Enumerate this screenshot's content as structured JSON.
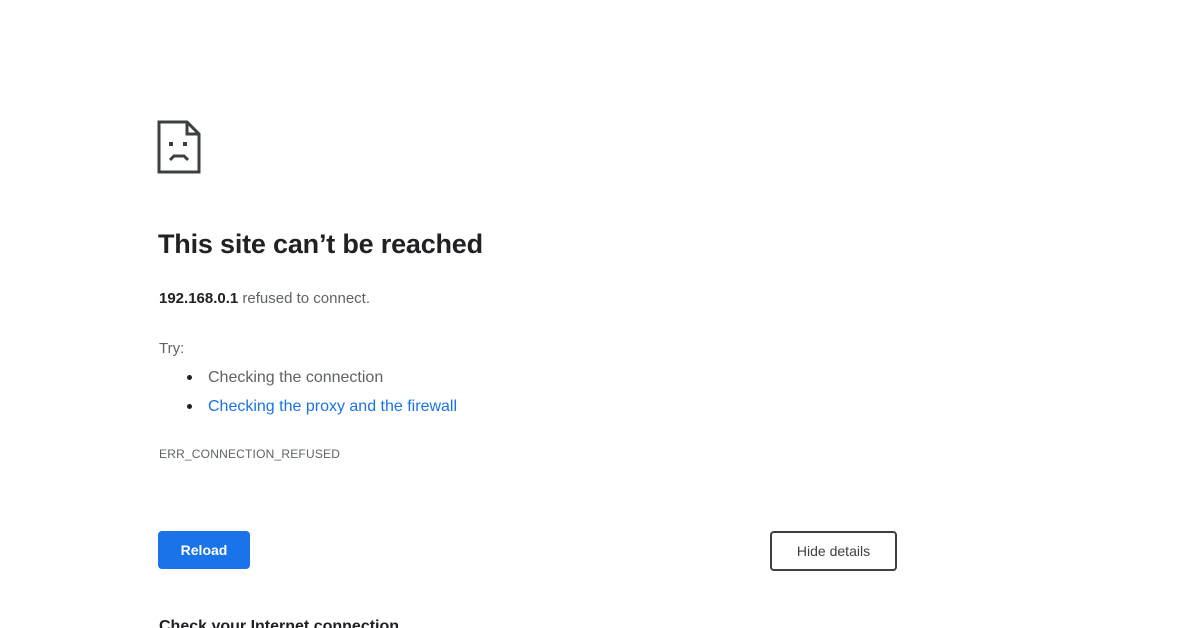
{
  "error": {
    "icon": "sad-document-icon",
    "title": "This site can’t be reached",
    "host": "192.168.0.1",
    "message": " refused to connect.",
    "try_label": "Try:",
    "suggestions": [
      {
        "label": "Checking the connection",
        "is_link": false
      },
      {
        "label": "Checking the proxy and the firewall",
        "is_link": true
      }
    ],
    "code": "ERR_CONNECTION_REFUSED"
  },
  "buttons": {
    "reload_label": "Reload",
    "details_label": "Hide details"
  },
  "details": {
    "heading": "Check your Internet connection"
  },
  "colors": {
    "primary": "#1a73e8",
    "link": "#1a73e8",
    "text": "#202124",
    "secondary_text": "#5f6368"
  }
}
